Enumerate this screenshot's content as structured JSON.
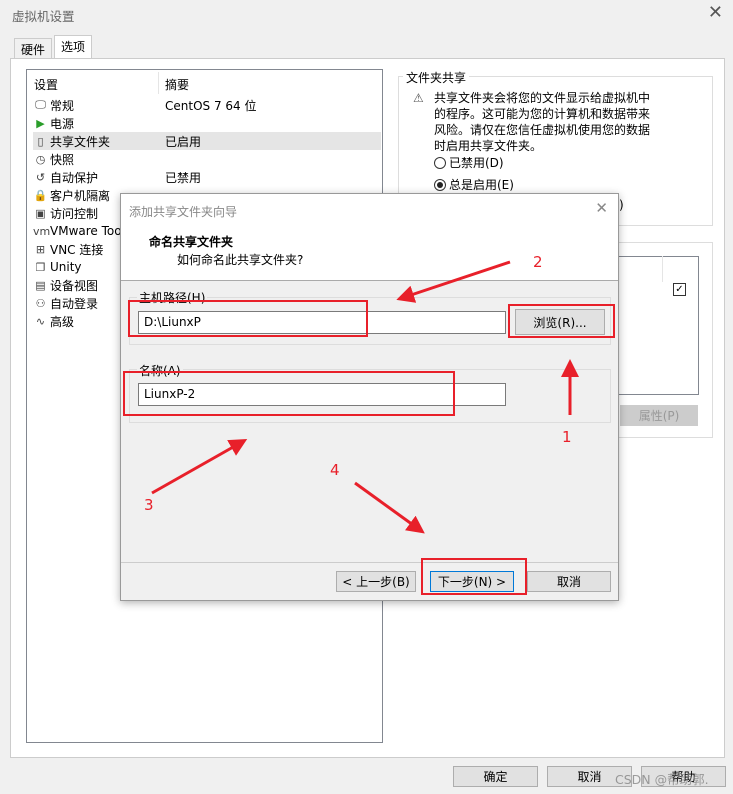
{
  "window": {
    "title": "虚拟机设置"
  },
  "tabs": [
    {
      "label": "硬件"
    },
    {
      "label": "选项",
      "active": true
    }
  ],
  "settings_list": {
    "headers": [
      "设置",
      "摘要"
    ],
    "items": [
      {
        "label": "常规",
        "summary": "CentOS 7 64 位",
        "icon": "monitor-icon"
      },
      {
        "label": "电源",
        "summary": "",
        "icon": "play-icon"
      },
      {
        "label": "共享文件夹",
        "summary": "已启用",
        "icon": "folder-share-icon",
        "selected": true
      },
      {
        "label": "快照",
        "summary": "",
        "icon": "snapshot-icon"
      },
      {
        "label": "自动保护",
        "summary": "已禁用",
        "icon": "history-icon"
      },
      {
        "label": "客户机隔离",
        "summary": "",
        "icon": "lock-icon"
      },
      {
        "label": "访问控制",
        "summary": "",
        "icon": "access-lock-icon"
      },
      {
        "label": "VMware Tools",
        "summary": "",
        "icon": "vm-icon"
      },
      {
        "label": "VNC 连接",
        "summary": "",
        "icon": "vnc-icon"
      },
      {
        "label": "Unity",
        "summary": "",
        "icon": "unity-icon"
      },
      {
        "label": "设备视图",
        "summary": "",
        "icon": "device-view-icon"
      },
      {
        "label": "自动登录",
        "summary": "",
        "icon": "users-icon"
      },
      {
        "label": "高级",
        "summary": "",
        "icon": "waveform-icon"
      }
    ]
  },
  "folder_sharing": {
    "title": "文件夹共享",
    "warning": "共享文件夹会将您的文件显示给虚拟机中的程序。这可能为您的计算机和数据带来风险。请仅在您信任虚拟机使用您的数据时启用共享文件夹。",
    "options": [
      {
        "label": "已禁用(D)",
        "checked": false
      },
      {
        "label": "总是启用(E)",
        "checked": true
      }
    ],
    "hidden_option_tail": ")"
  },
  "folders": {
    "properties_label": "属性(P)"
  },
  "footer": {
    "ok": "确定",
    "cancel": "取消",
    "help": "帮助"
  },
  "watermark": "CSDN @帮助郭.",
  "wizard": {
    "title": "添加共享文件夹向导",
    "heading": "命名共享文件夹",
    "subheading": "如何命名此共享文件夹?",
    "host_path_label": "主机路径(H)",
    "host_path_value": "D:\\LiunxP",
    "browse_label": "浏览(R)...",
    "name_label": "名称(A)",
    "name_value": "LiunxP-2",
    "back_label": "< 上一步(B)",
    "next_label": "下一步(N) >",
    "cancel_label": "取消"
  },
  "annotations": [
    "1",
    "2",
    "3",
    "4"
  ],
  "colors": {
    "annotation": "#e8202a",
    "accent": "#0063b1"
  }
}
